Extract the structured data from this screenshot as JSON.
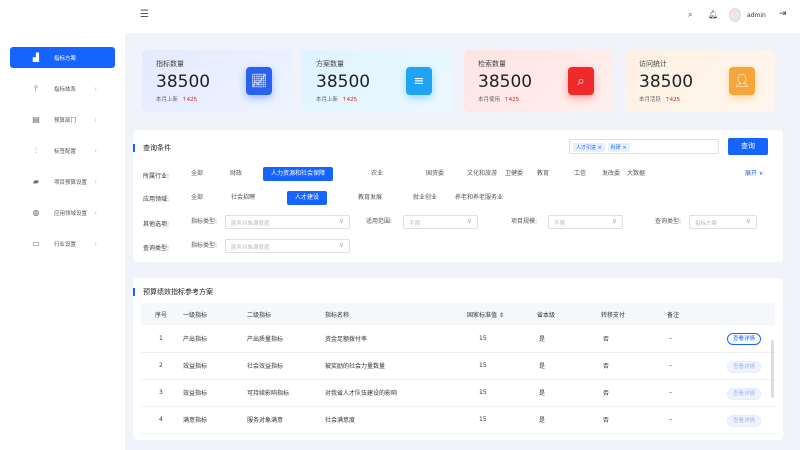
{
  "header": {
    "user": "admin"
  },
  "sidebar": {
    "items": [
      {
        "label": "指标方案",
        "icon": "bar-chart"
      },
      {
        "label": "指标体系",
        "icon": "hierarchy"
      },
      {
        "label": "预算部门",
        "icon": "building"
      },
      {
        "label": "标签配置",
        "icon": "sliders"
      },
      {
        "label": "项目预算设置",
        "icon": "folder"
      },
      {
        "label": "应用领域设置",
        "icon": "globe"
      },
      {
        "label": "行业设置",
        "icon": "briefcase"
      }
    ]
  },
  "cards": [
    {
      "title": "指标数量",
      "value": "38500",
      "sub": "本月上新",
      "delta": "425",
      "color": "#2a62f0"
    },
    {
      "title": "方案数量",
      "value": "38500",
      "sub": "本月上新",
      "delta": "425",
      "color": "#1ea4f2"
    },
    {
      "title": "检索数量",
      "value": "38500",
      "sub": "本月使用",
      "delta": "425",
      "color": "#f02a2a"
    },
    {
      "title": "访问统计",
      "value": "38500",
      "sub": "本月活跃",
      "delta": "425",
      "color": "#f5a53a"
    }
  ],
  "query": {
    "title": "查询条件",
    "tags": [
      "人才引进",
      "科研"
    ],
    "search_button": "查询",
    "industry_label": "所属行业:",
    "industries": [
      "全部",
      "财政",
      "人力资源和社会保障",
      "农业",
      "国资委",
      "文化和旅游",
      "卫健委",
      "教育",
      "工信",
      "发改委",
      "大数据"
    ],
    "expand": "展开",
    "domain_label": "应用领域:",
    "domains": [
      "全部",
      "社会招聘",
      "人才建设",
      "教育发展",
      "就业创业",
      "养老和养老服务业"
    ],
    "other_label": "其他选项:",
    "query_type_label": "查询类型:",
    "filters": [
      {
        "label": "指标类型:",
        "placeholder": "服务对象满意度"
      },
      {
        "label": "适用范围:",
        "placeholder": "不限"
      },
      {
        "label": "项目规模:",
        "placeholder": "不限"
      },
      {
        "label": "查询类型:",
        "placeholder": "指标方案"
      }
    ],
    "filter2": {
      "label": "指标类型:",
      "placeholder": "服务对象满意度"
    }
  },
  "table": {
    "title": "预算绩效指标参考方案",
    "columns": [
      "序号",
      "一级指标",
      "二级指标",
      "指标名称",
      "国家标准值 ⇕",
      "省本级",
      "转移支付",
      "备注",
      ""
    ],
    "rows": [
      [
        "1",
        "产出指标",
        "产出质量指标",
        "资金足额拨付率",
        "15",
        "是",
        "否",
        "–",
        "查看详情"
      ],
      [
        "2",
        "效益指标",
        "社会效益指标",
        "被奖励的社会力量数量",
        "15",
        "是",
        "否",
        "–",
        "查看详情"
      ],
      [
        "3",
        "效益指标",
        "可持续影响指标",
        "对我省人才队伍建设的影响",
        "15",
        "是",
        "否",
        "–",
        "查看详情"
      ],
      [
        "4",
        "满意指标",
        "服务对象满意",
        "社会满意度",
        "15",
        "是",
        "否",
        "–",
        "查看详情"
      ]
    ]
  }
}
